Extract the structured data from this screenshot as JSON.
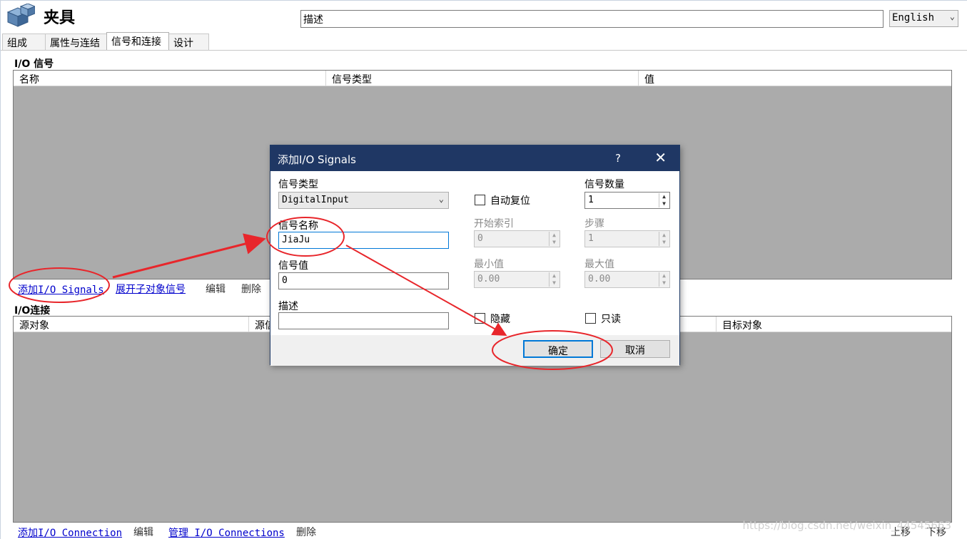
{
  "window": {
    "title": "夹具",
    "description_value": "描述",
    "language": "English"
  },
  "tabs": [
    {
      "label": "组成"
    },
    {
      "label": "属性与连结"
    },
    {
      "label": "信号和连接",
      "active": true
    },
    {
      "label": "设计"
    }
  ],
  "io_signals": {
    "label": "I/O 信号",
    "columns": [
      "名称",
      "信号类型",
      "值"
    ],
    "actions": {
      "add": "添加I/O Signals",
      "expand": "展开子对象信号",
      "edit": "编辑",
      "delete": "删除"
    }
  },
  "io_connections": {
    "label": "I/O连接",
    "columns": [
      "源对象",
      "源信",
      "目标对象"
    ],
    "actions": {
      "add": "添加I/O Connection",
      "edit": "编辑",
      "manage": "管理 I/O Connections",
      "delete": "删除",
      "move_up": "上移",
      "move_down": "下移"
    }
  },
  "dialog": {
    "title": "添加I/O Signals",
    "help": "?",
    "signal_type_label": "信号类型",
    "signal_type_value": "DigitalInput",
    "auto_reset_label": "自动复位",
    "signal_count_label": "信号数量",
    "signal_count_value": "1",
    "signal_name_label": "信号名称",
    "signal_name_value": "JiaJu",
    "start_index_label": "开始索引",
    "start_index_value": "0",
    "step_label": "步骤",
    "step_value": "1",
    "signal_value_label": "信号值",
    "signal_value_value": "0",
    "min_label": "最小值",
    "min_value": "0.00",
    "max_label": "最大值",
    "max_value": "0.00",
    "description_label": "描述",
    "description_value": "",
    "hidden_label": "隐藏",
    "readonly_label": "只读",
    "ok_label": "确定",
    "cancel_label": "取消"
  },
  "watermark": "https://blog.csdn.net/weixin_44545663",
  "annotation_color": "#e8262b"
}
